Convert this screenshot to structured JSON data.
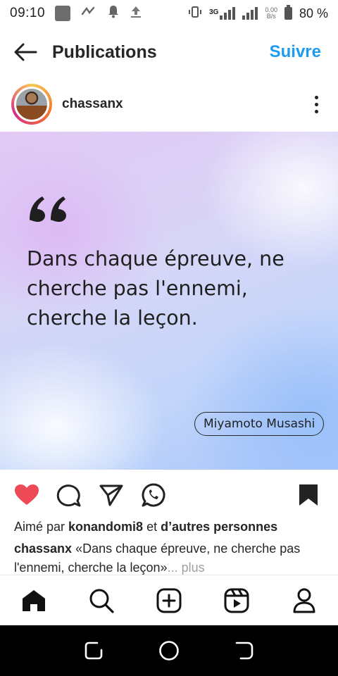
{
  "status_bar": {
    "time": "09:10",
    "network": "3G",
    "speed_top": "0.00",
    "speed_bottom": "B/s",
    "battery": "80 %"
  },
  "header": {
    "title": "Publications",
    "follow_label": "Suivre"
  },
  "post": {
    "author": "chassanx",
    "image": {
      "quote": "Dans chaque épreuve, ne cherche pas l'ennemi, cherche la leçon.",
      "attribution": "Miyamoto Musashi"
    },
    "likes": {
      "prefix": "Aimé par",
      "user": "konandomi8",
      "conjunction": "et",
      "others": "d’autres personnes"
    },
    "caption": {
      "author": "chassanx",
      "text": "«Dans chaque épreuve, ne cherche pas l'ennemi, cherche la leçon»",
      "more": "... plus"
    }
  },
  "icons": {
    "back": "arrow-left-icon",
    "more": "more-vertical-icon",
    "like": "heart-icon",
    "comment": "comment-icon",
    "share": "send-icon",
    "whatsapp": "whatsapp-icon",
    "save": "bookmark-icon",
    "nav": [
      "home-icon",
      "search-icon",
      "add-post-icon",
      "reels-icon",
      "profile-icon"
    ]
  },
  "colors": {
    "accent": "#1d9bf0",
    "like": "#ed4956",
    "text": "#262626"
  }
}
